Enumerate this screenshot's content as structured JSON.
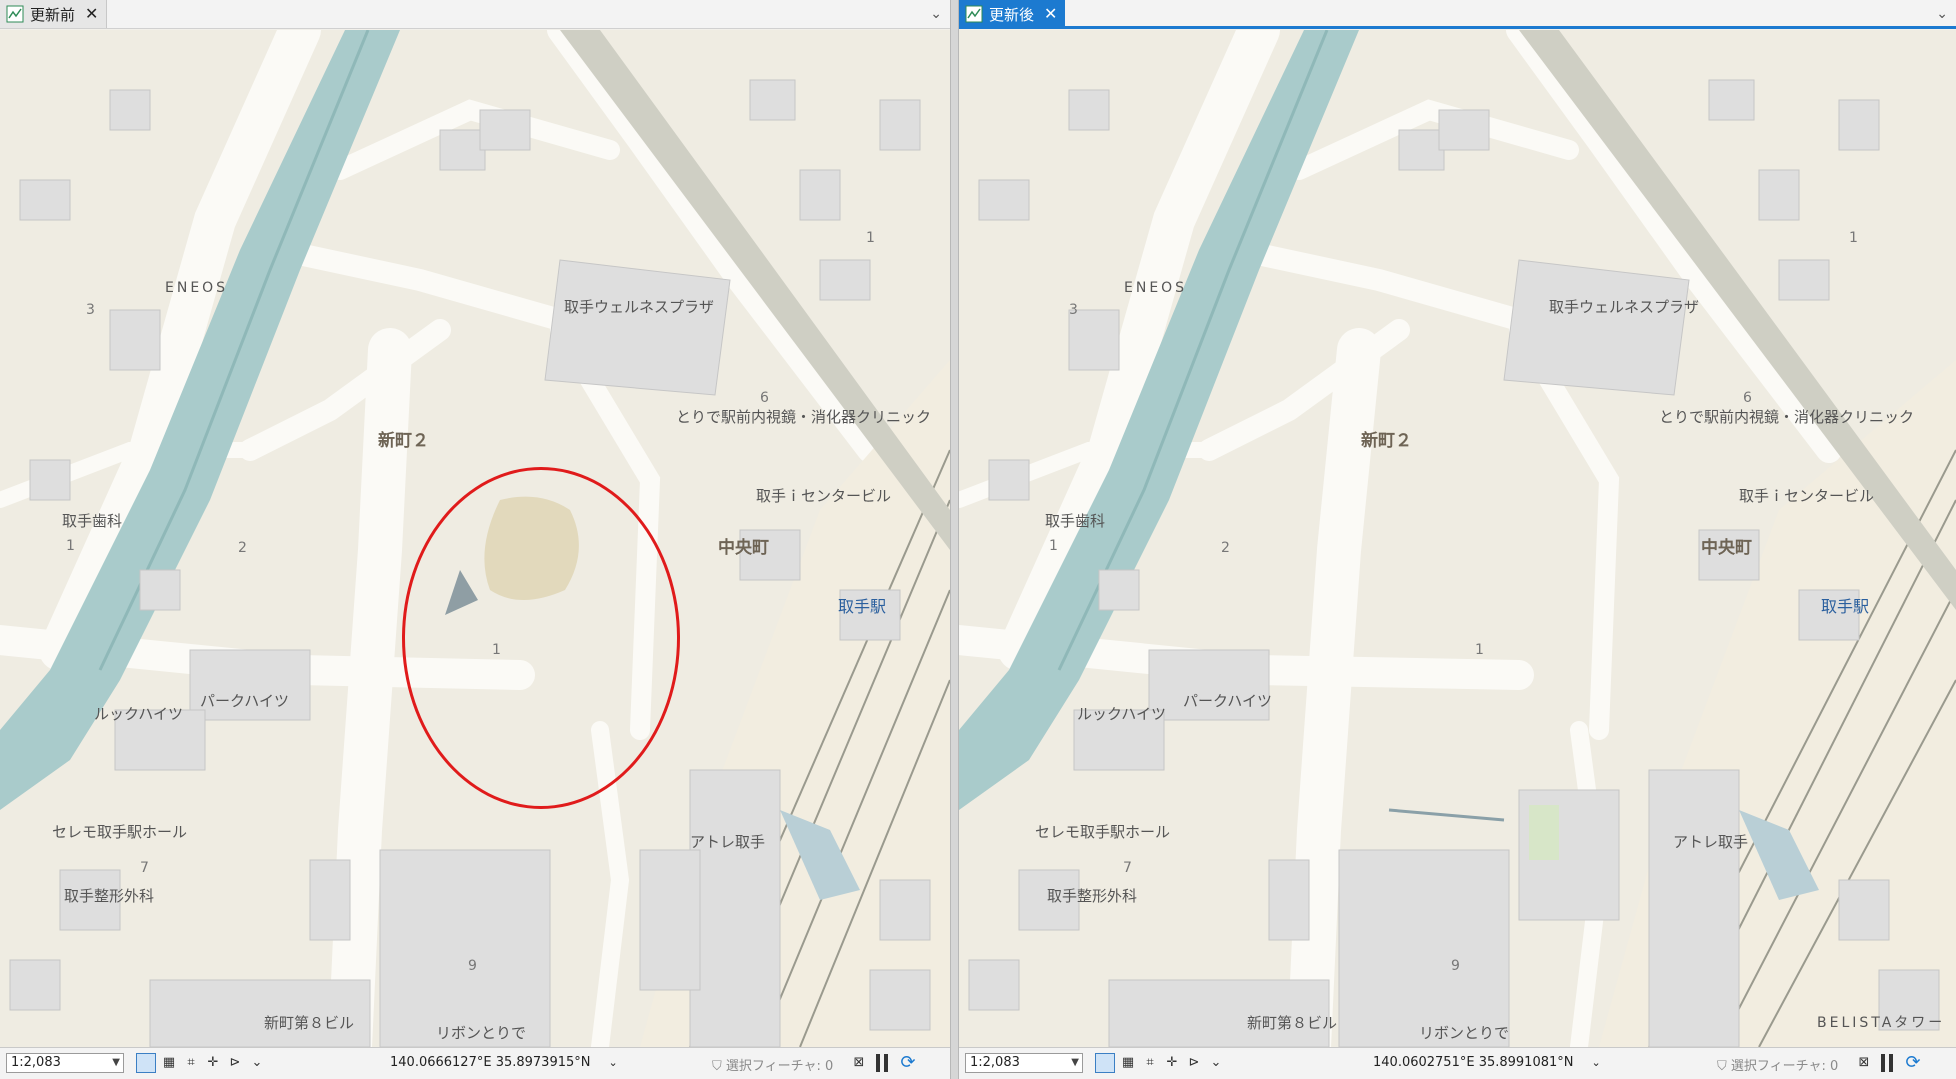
{
  "left_pane": {
    "tab_label": "更新前",
    "close_glyph": "✕",
    "scale": "1:2,083",
    "coordinates": "140.0666127°E 35.8973915°N",
    "selected_features": "選択フィーチャ: 0",
    "labels": {
      "eneos": "ENEOS",
      "wellness": "取手ウェルネスプラザ",
      "clinic": "とりで駅前内視鏡・消化器クリニック",
      "shinmachi2": "新町２",
      "icenter": "取手ｉセンタービル",
      "chuo": "中央町",
      "station": "取手駅",
      "dental": "取手歯科",
      "look_heights": "ルックハイツ",
      "park_heights": "パークハイツ",
      "seremo": "セレモ取手駅ホール",
      "orthopedic": "取手整形外科",
      "atre": "アトレ取手",
      "shinmachi8": "新町第８ビル",
      "ribbon": "リボンとりで",
      "n3": "3",
      "n1a": "1",
      "n6": "6",
      "n2": "2",
      "n1b": "1",
      "n1c": "1",
      "n7": "7",
      "n9": "9"
    }
  },
  "right_pane": {
    "tab_label": "更新後",
    "close_glyph": "✕",
    "scale": "1:2,083",
    "coordinates": "140.0602751°E 35.8991081°N",
    "selected_features": "選択フィーチャ: 0",
    "labels": {
      "eneos": "ENEOS",
      "wellness": "取手ウェルネスプラザ",
      "clinic": "とりで駅前内視鏡・消化器クリニック",
      "shinmachi2": "新町２",
      "icenter": "取手ｉセンタービル",
      "chuo": "中央町",
      "station": "取手駅",
      "dental": "取手歯科",
      "look_heights": "ルックハイツ",
      "park_heights": "パークハイツ",
      "seremo": "セレモ取手駅ホール",
      "orthopedic": "取手整形外科",
      "atre": "アトレ取手",
      "shinmachi8": "新町第８ビル",
      "ribbon": "リボンとりで",
      "belista": "BELISTAタワー",
      "n3": "3",
      "n1a": "1",
      "n6": "6",
      "n2": "2",
      "n1b": "1",
      "n1c": "1",
      "n7": "7",
      "n9": "9"
    }
  },
  "colors": {
    "river": "#a9cbcb",
    "land": "#efece2",
    "road": "#fbfaf6",
    "building": "#dedede",
    "highlight_circle": "#e01b1b",
    "accent": "#1c7ad0"
  },
  "icons": [
    "map-tab-icon",
    "navigate-tool-icon",
    "grid-icon",
    "snapping-icon",
    "constraint-icon",
    "measure-icon",
    "filter-icon",
    "pause-icon",
    "refresh-icon"
  ]
}
